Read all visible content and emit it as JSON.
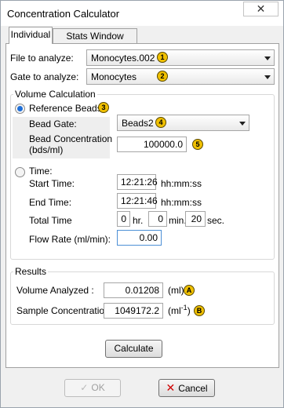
{
  "window": {
    "title": "Concentration Calculator",
    "close_glyph": "✕"
  },
  "tabs": [
    {
      "label": "Individual",
      "active": true
    },
    {
      "label": "Stats Window Setup",
      "active": false
    }
  ],
  "file": {
    "label": "File to analyze:",
    "value": "Monocytes.002",
    "badge": "1"
  },
  "gate": {
    "label": "Gate to analyze:",
    "value": "Monocytes",
    "badge": "2"
  },
  "volume": {
    "group_title": "Volume Calculation",
    "reference_beads": {
      "label": "Reference Beads",
      "checked": true,
      "badge": "3"
    },
    "bead_gate": {
      "label": "Bead Gate:",
      "value": "Beads2",
      "badge": "4"
    },
    "bead_concentration": {
      "label_line1": "Bead Concentration",
      "label_line2": "(bds/ml)",
      "value": "100000.0",
      "badge": "5"
    },
    "time": {
      "label": "Time:",
      "checked": false
    },
    "start_time": {
      "label": "Start Time:",
      "value": "12:21:26",
      "unit": "hh:mm:ss"
    },
    "end_time": {
      "label": "End Time:",
      "value": "12:21:46",
      "unit": "hh:mm:ss"
    },
    "total_time": {
      "label": "Total Time",
      "hr": "0",
      "hr_unit": "hr.",
      "min": "0",
      "min_unit": "min.",
      "sec": "20",
      "sec_unit": "sec."
    },
    "flow_rate": {
      "label": "Flow Rate (ml/min):",
      "value": "0.00"
    }
  },
  "results": {
    "group_title": "Results",
    "volume_analyzed": {
      "label": "Volume Analyzed :",
      "value": "0.01208",
      "unit": "(ml)",
      "badge": "A"
    },
    "sample_concentration": {
      "label": "Sample Concentration:",
      "value": "1049172.2",
      "unit_prefix": "(ml",
      "unit_sup": "-1",
      "unit_suffix": ")",
      "badge": "B"
    }
  },
  "buttons": {
    "calculate": "Calculate",
    "ok": "OK",
    "ok_icon": "check-icon",
    "cancel": "Cancel",
    "cancel_icon": "x-icon"
  },
  "colors": {
    "badge": "#f0c000",
    "radio_checked": "#1e6fd9",
    "cancel_icon": "#d00000"
  }
}
